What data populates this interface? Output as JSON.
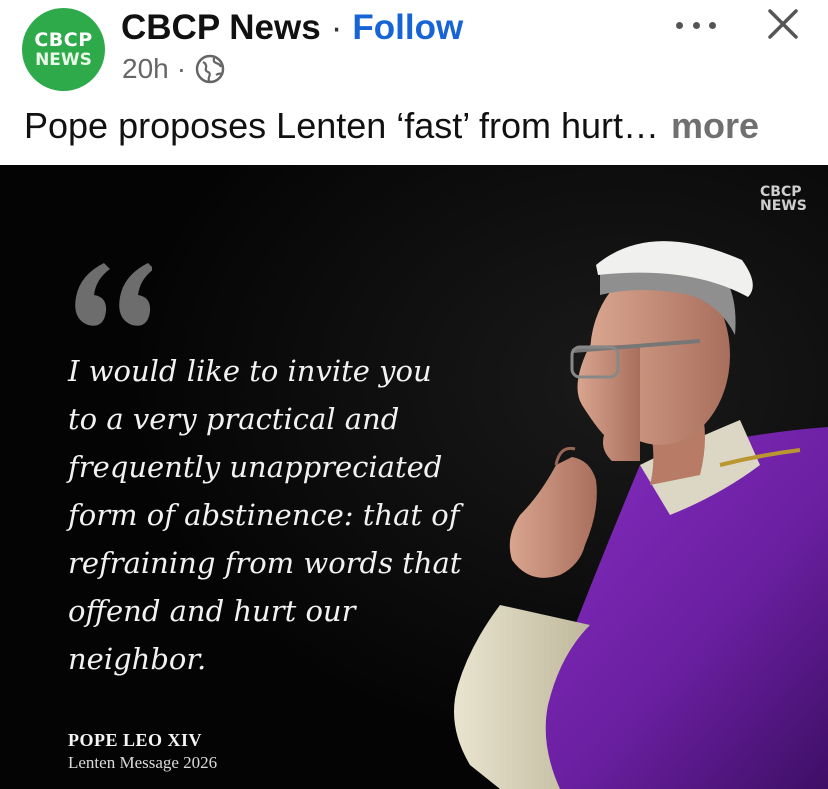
{
  "post": {
    "avatar_line1": "CBCP",
    "avatar_line2": "NEWS",
    "page_name": "CBCP News",
    "separator": "·",
    "follow_label": "Follow",
    "time": "20h",
    "visibility_icon": "globe-icon",
    "menu_icon": "more-horizontal-icon",
    "close_icon": "close-icon",
    "caption": "Pope proposes Lenten ‘fast’ from hurt…",
    "caption_more": "more"
  },
  "image": {
    "watermark_line1": "CBCP",
    "watermark_line2": "NEWS",
    "quote_icon": "quote-mark-icon",
    "quote": "I would like to invite you\nto a very practical and\nfrequently unappreciated\nform of abstinence: that of\nrefraining from words that\noffend and hurt our\nneighbor.",
    "attribution_name": "POPE LEO XIV",
    "attribution_source": "Lenten Message 2026"
  },
  "colors": {
    "avatar_green": "#2faa4b",
    "follow_blue": "#1664d6",
    "vestment_purple": "#6a1fa0",
    "background_black": "#050505"
  }
}
